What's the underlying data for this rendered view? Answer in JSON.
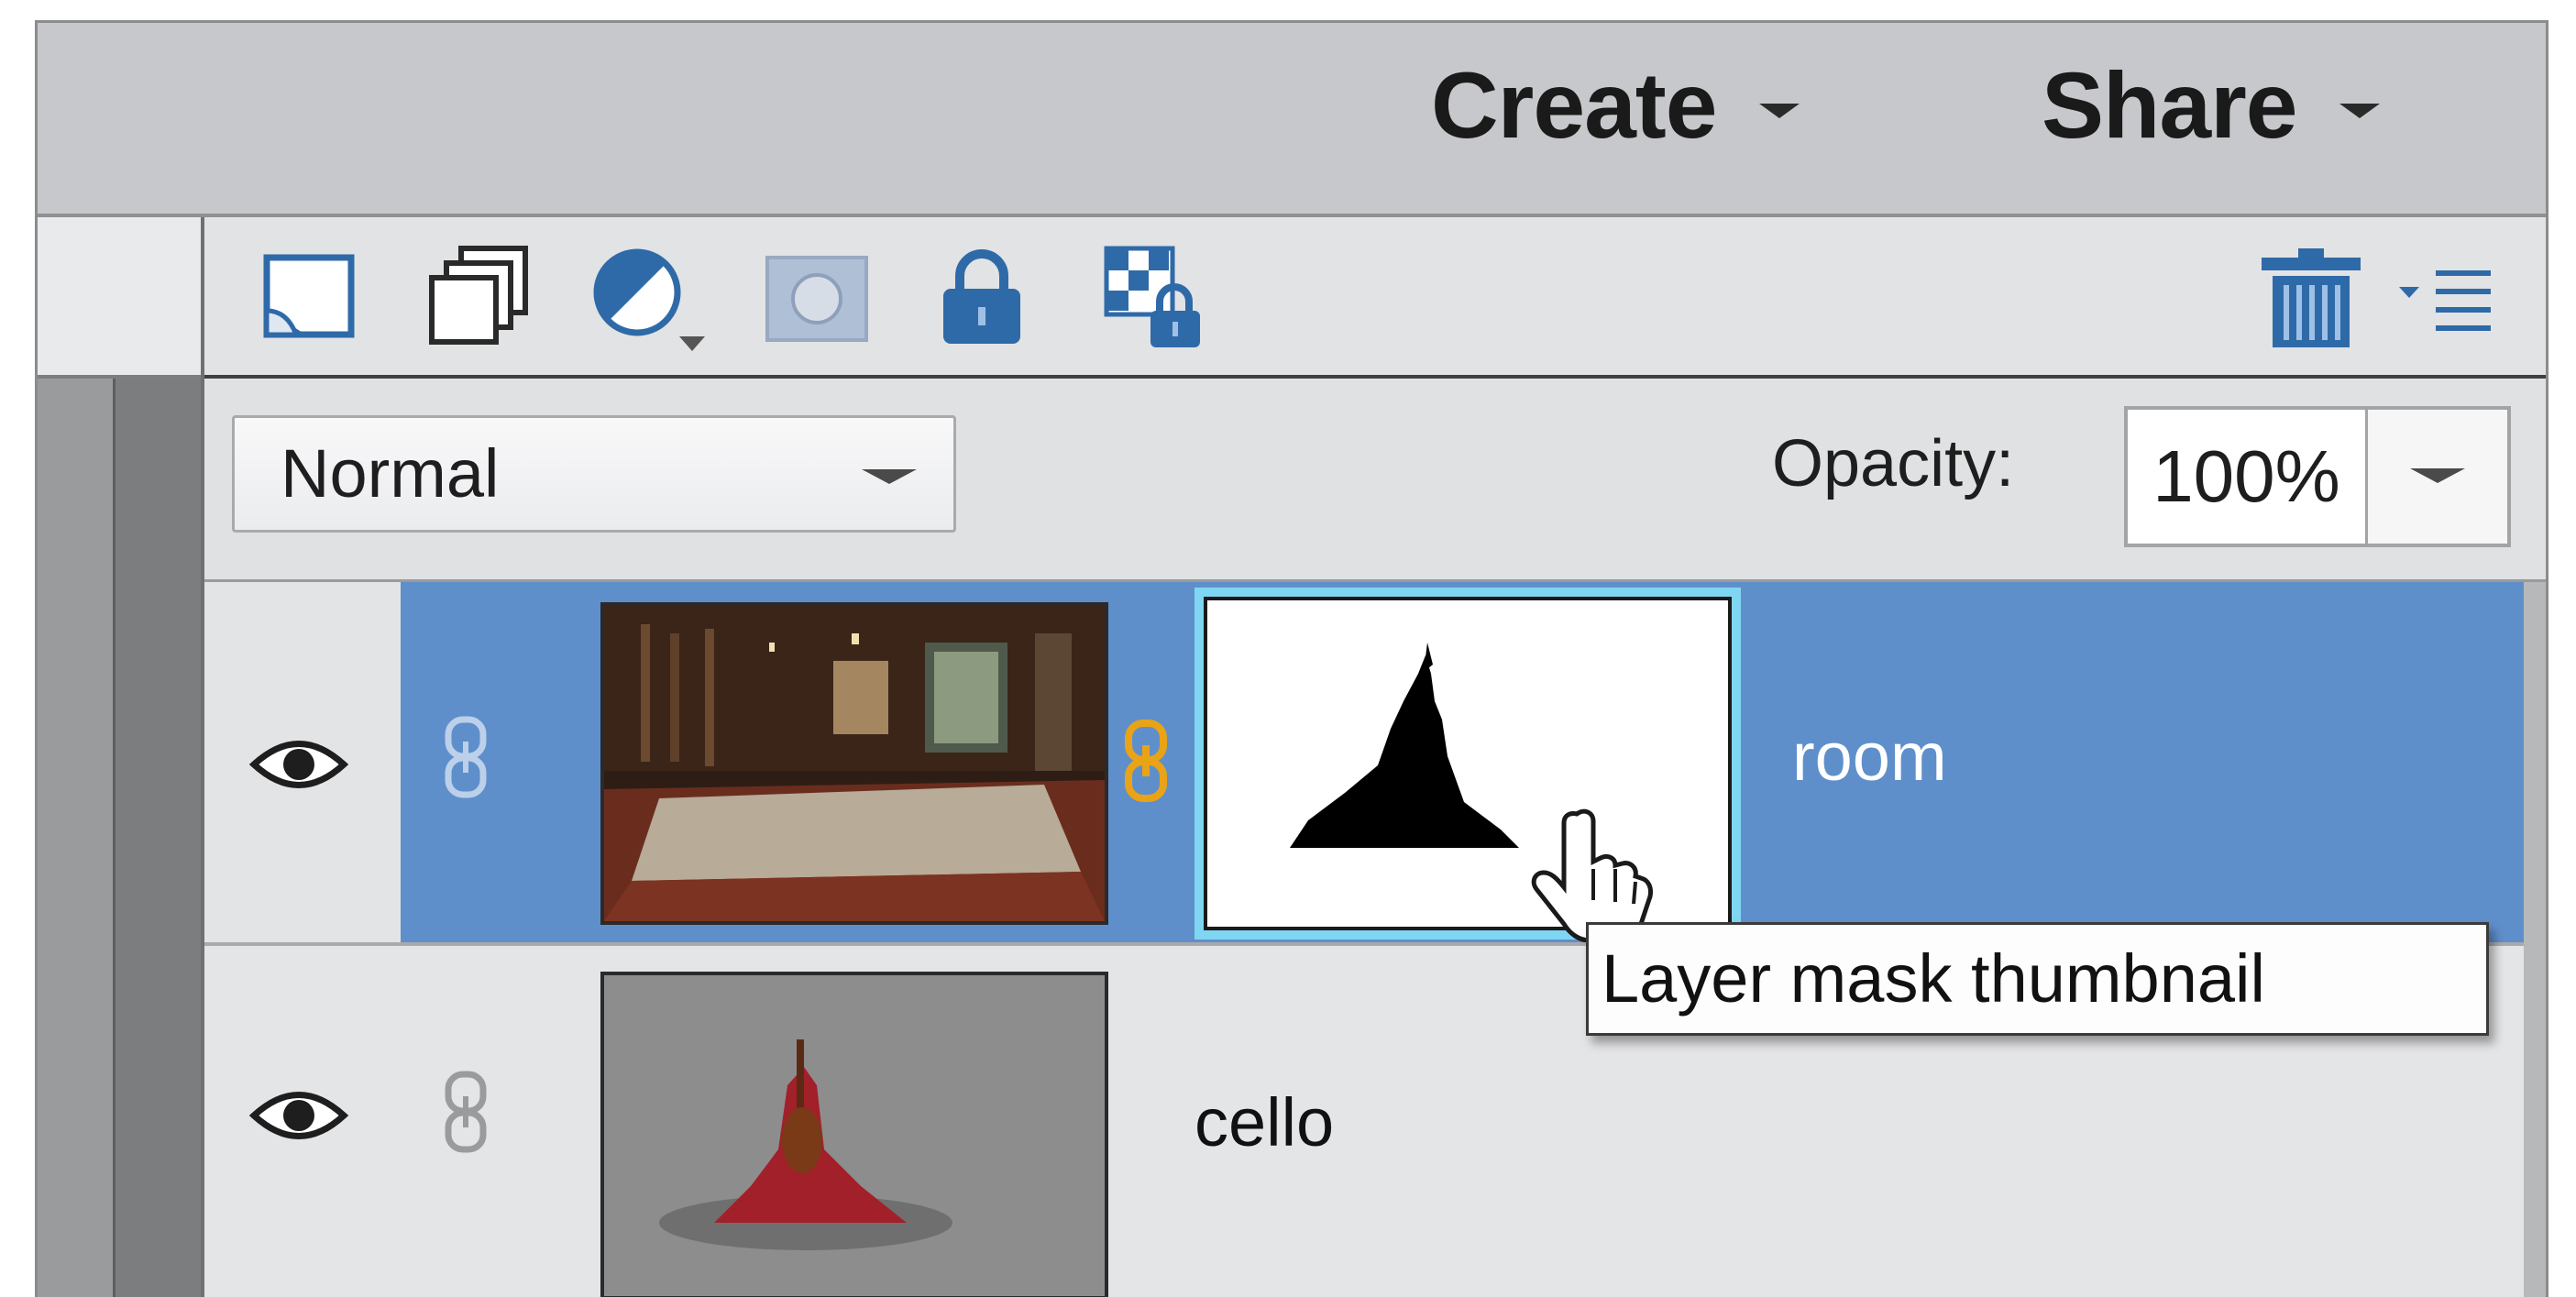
{
  "header": {
    "create_label": "Create",
    "share_label": "Share"
  },
  "toolbar": {
    "icons": [
      "new-layer-icon",
      "new-group-icon",
      "adjustment-layer-icon",
      "add-mask-icon",
      "lock-all-icon",
      "lock-transparency-icon",
      "trash-icon",
      "panel-menu-icon"
    ]
  },
  "blend": {
    "mode": "Normal",
    "opacity_label": "Opacity:",
    "opacity_value": "100%"
  },
  "layers": [
    {
      "name": "room",
      "selected": true,
      "has_mask": true,
      "visible": true
    },
    {
      "name": "cello",
      "selected": false,
      "has_mask": false,
      "visible": true
    }
  ],
  "tooltip": "Layer mask thumbnail",
  "colors": {
    "selection": "#5f8fcb",
    "mask_highlight": "#7fd6f2",
    "link_active": "#e8a317"
  }
}
